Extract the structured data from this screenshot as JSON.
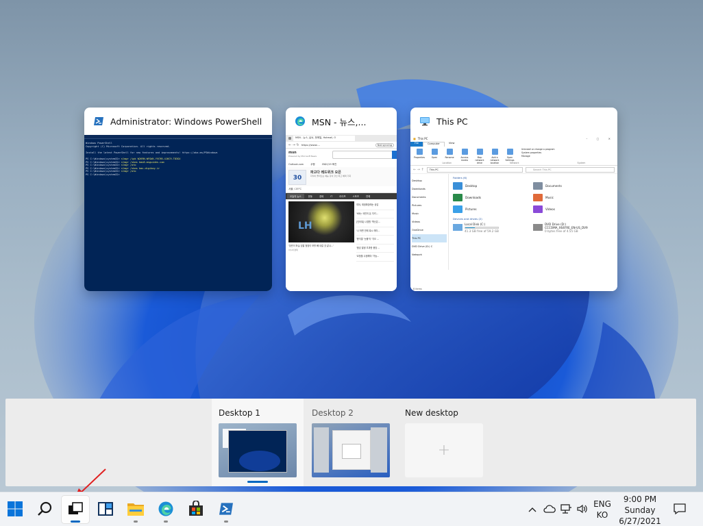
{
  "windows": [
    {
      "title": "Administrator: Windows PowerShell",
      "icon": "powershell-icon"
    },
    {
      "title": "MSN - 뉴스,...",
      "icon": "edge-icon"
    },
    {
      "title": "This PC",
      "icon": "this-pc-icon"
    }
  ],
  "powershell": {
    "titlebar": "Administrator: Windows PowerShell",
    "lines": [
      "Windows PowerShell",
      "Copyright (C) Microsoft Corporation. All rights reserved.",
      "",
      "Install the latest PowerShell for new features and improvements! https://aka.ms/PSWindows",
      "",
      "PS C:\\Windows\\system32> slmgr /ipk W269N-WFGWX-YVC9B-4J6C9-T83GX",
      "PS C:\\Windows\\system32> slmgr /skms kms8.msguides.com",
      "PS C:\\Windows\\system32> slmgr /ato",
      "PS C:\\Windows\\system32> slmgr /skms kms.digiboy.ir",
      "PS C:\\Windows\\system32> slmgr /ato",
      "PS C:\\Windows\\system32>"
    ]
  },
  "msn": {
    "tab": "MSN - 뉴스, 날씨, 핫메일, Hotmail, O",
    "url": "https://www....",
    "not_syncing": "Not syncing",
    "brand": "msn",
    "brand_sub": "Powered by Microsoft News",
    "quick_links": [
      "Outlook.com",
      "쿠팡",
      "코로나19 확진"
    ],
    "ad_title": "파고다 레드위크 오픈",
    "ad_text": "지식이 돌아오는 예능 강의 할인 최고 혜택 기회",
    "weather": "서울 / 25°C",
    "nav": [
      "오늘의 뉴스",
      "운동",
      "경제",
      "IT",
      "라이프",
      "스포츠",
      "연예"
    ],
    "headlines": [
      "여야, 재정확장에는 공감",
      "'KB는 국민의 돈 지키...",
      "[인터뷰] 나경원 '혁신은...",
      "'나 하면 안돼 혹시 레이...",
      "'윤석열 '눈물'의 '각오 ...",
      "'음성 발생 초과한 중앙 ...",
      "'요청을 수정해야 '가능..."
    ],
    "news_caption": "'장관이 하실 검찰 청장이 보를 빼 내걸 것 같냐...'",
    "news_source": "아시아경제"
  },
  "explorer": {
    "title": "This PC",
    "ribbon_tabs": [
      "File",
      "Computer",
      "View"
    ],
    "ribbon_groups": [
      "Location",
      "Network",
      "System"
    ],
    "ribbon_buttons": [
      "Properties",
      "Open",
      "Rename",
      "Access media",
      "Map network drive",
      "Add a network location",
      "Open Settings"
    ],
    "system_links": [
      "Uninstall or change a program",
      "System properties",
      "Manage"
    ],
    "address": "This PC",
    "search_placeholder": "Search This PC",
    "nav_items": [
      "Desktop",
      "Downloads",
      "Documents",
      "Pictures",
      "Music",
      "Videos",
      "OneDrive",
      "This PC",
      "DVD Drive (D:) C",
      "Network"
    ],
    "folders_header": "Folders (6)",
    "folders": [
      "Desktop",
      "Documents",
      "Downloads",
      "Music",
      "Pictures",
      "Videos"
    ],
    "drives_header": "Devices and drives (2)",
    "drives": [
      {
        "name": "Local Disk (C:)",
        "info": "41.3 GB free of 59.2 GB",
        "used": 0.3
      },
      {
        "name": "DVD Drive (D:)",
        "label": "CCCOMA_X64FRE_EN-US_DV9",
        "info": "0 bytes free of 4.55 GB"
      }
    ],
    "status": "8 items"
  },
  "desktops": [
    {
      "label": "Desktop 1",
      "active": true
    },
    {
      "label": "Desktop 2",
      "active": false
    },
    {
      "label": "New desktop",
      "active": false
    }
  ],
  "taskbar": {
    "apps": [
      "start-icon",
      "search-icon",
      "task-view-icon",
      "widgets-icon",
      "file-explorer-icon",
      "edge-icon",
      "store-icon",
      "powershell-icon"
    ],
    "lang_top": "ENG",
    "lang_bottom": "KO",
    "time": "9:00 PM",
    "day": "Sunday",
    "date": "6/27/2021"
  },
  "colors": {
    "accent": "#0067c0",
    "ps_bg": "#012456",
    "annotation": "#e02020"
  }
}
